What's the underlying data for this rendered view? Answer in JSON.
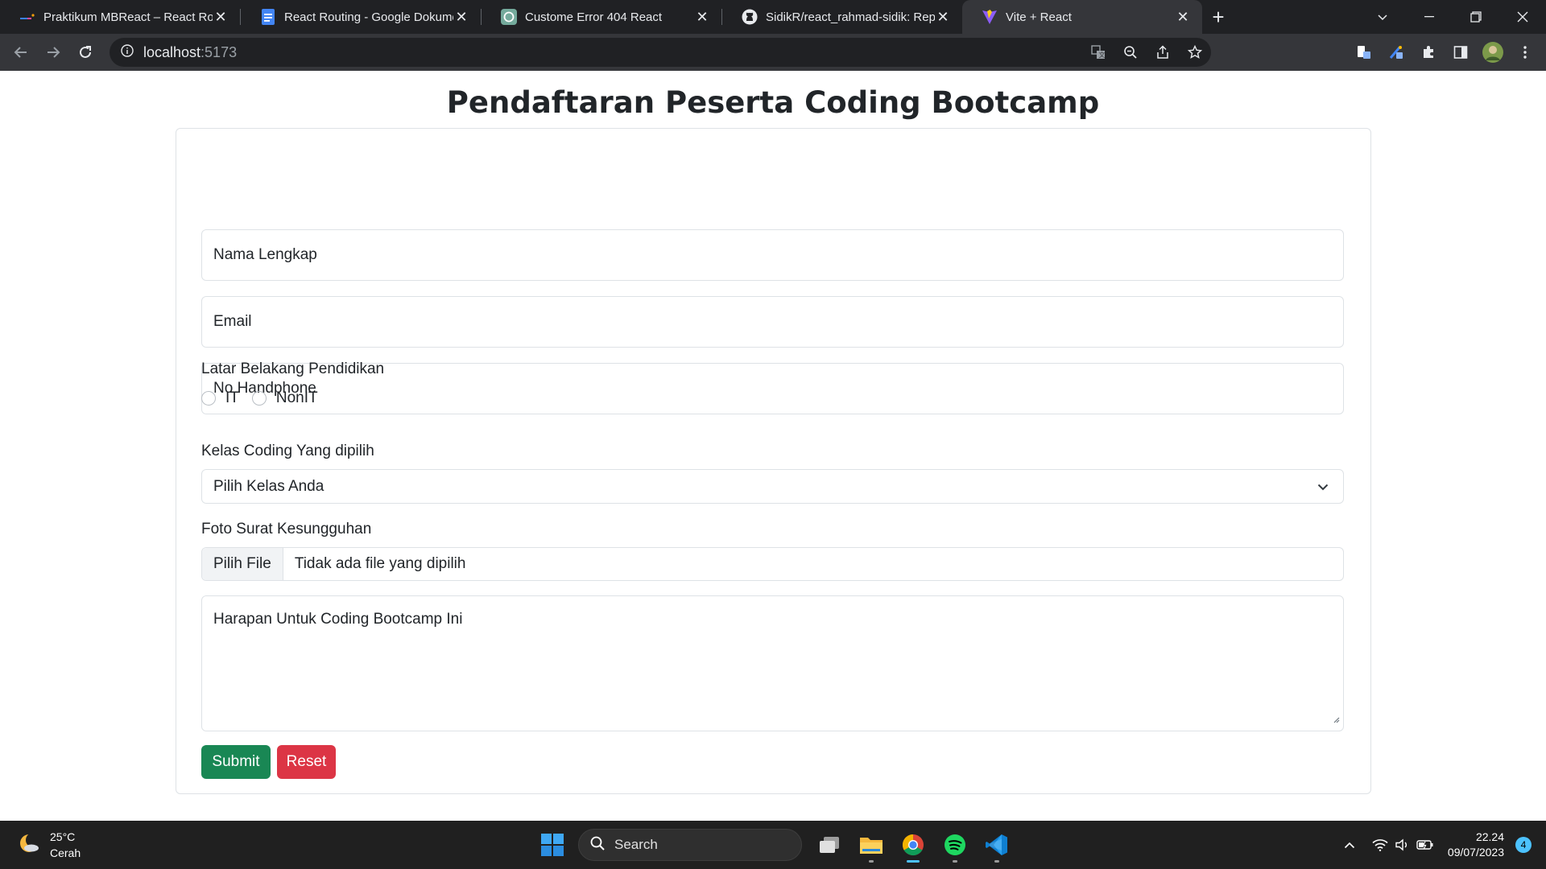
{
  "browser": {
    "tabs": [
      {
        "title": "Praktikum MBReact – React Routi",
        "icon": "kampus-merdeka-icon",
        "active": false
      },
      {
        "title": "React Routing - Google Dokumen",
        "icon": "google-docs-icon",
        "active": false
      },
      {
        "title": "Custome Error 404 React",
        "icon": "chatgpt-icon",
        "active": false
      },
      {
        "title": "SidikR/react_rahmad-sidik: Repos",
        "icon": "github-icon",
        "active": false
      },
      {
        "title": "Vite + React",
        "icon": "vite-icon",
        "active": true
      }
    ],
    "url_host": "localhost",
    "url_port": ":5173"
  },
  "page": {
    "title": "Pendaftaran Peserta Coding Bootcamp",
    "form": {
      "name_placeholder": "Nama Lengkap",
      "email_placeholder": "Email",
      "phone_placeholder": "No Handphone",
      "education_label": "Latar Belakang Pendidikan",
      "education_options": [
        "IT",
        "NonIT"
      ],
      "class_label": "Kelas Coding Yang dipilih",
      "class_selected": "Pilih Kelas Anda",
      "file_label": "Foto Surat Kesungguhan",
      "file_button": "Pilih File",
      "file_status": "Tidak ada file yang dipilih",
      "hope_placeholder": "Harapan Untuk Coding Bootcamp Ini",
      "submit_label": "Submit",
      "reset_label": "Reset"
    },
    "colors": {
      "submit": "#198754",
      "reset": "#dc3545"
    }
  },
  "taskbar": {
    "weather_temp": "25°C",
    "weather_desc": "Cerah",
    "search_label": "Search",
    "time": "22.24",
    "date": "09/07/2023",
    "notification_count": "4"
  }
}
